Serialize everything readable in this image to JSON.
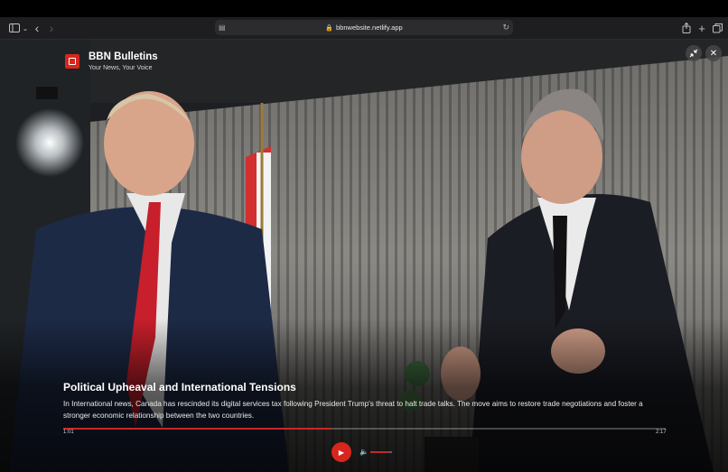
{
  "browser": {
    "url": "bbnwebsite.netlify.app",
    "icons": [
      "sidebar-icon",
      "chevron-down-icon",
      "back-icon",
      "forward-icon",
      "reader-icon",
      "lock-icon",
      "reload-icon",
      "share-icon",
      "new-tab-icon",
      "tabs-overview-icon"
    ]
  },
  "brand": {
    "title": "BBN Bulletins",
    "tagline": "Your News, Your Voice",
    "logo_color": "#d7261e"
  },
  "controls": {
    "minimize_icon": "collapse-icon",
    "close_icon": "close-icon"
  },
  "story": {
    "headline": "Political Upheaval and International Tensions",
    "summary": "In International news, Canada has rescinded its digital services tax following President Trump's threat to halt trade talks. The move aims to restore trade negotiations and foster a stronger economic relationship between the two countries."
  },
  "player": {
    "current_time": "1:01",
    "duration": "2:17",
    "progress_fraction": 0.445,
    "volume_fraction": 0.85,
    "accent_color": "#d7261e"
  }
}
